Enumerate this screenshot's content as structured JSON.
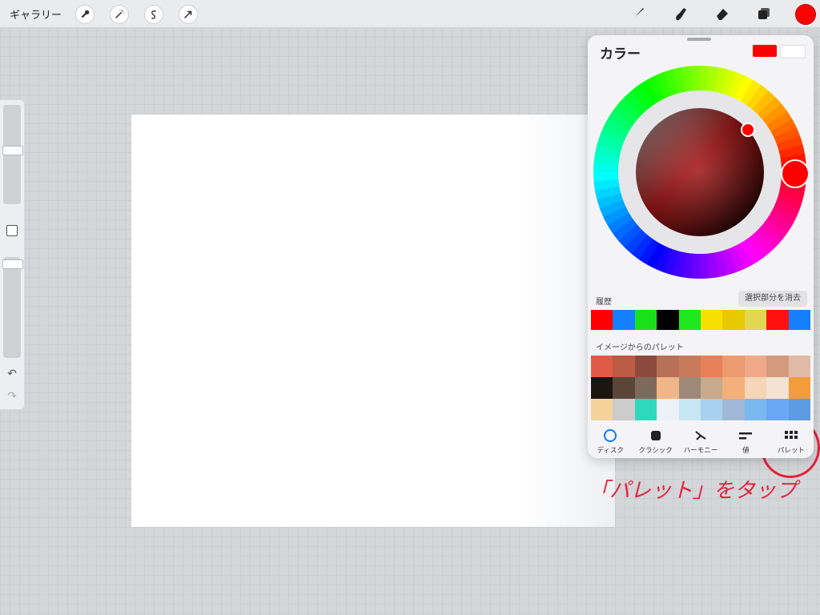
{
  "topbar": {
    "gallery_label": "ギャラリー",
    "left_tools": [
      "wrench-icon",
      "magic-wand-icon",
      "selection-icon",
      "transform-arrow-icon"
    ],
    "right_tools": [
      "brush-icon",
      "smudge-icon",
      "eraser-icon",
      "layers-icon"
    ],
    "current_color": "#ff0000"
  },
  "sidebar": {
    "top_slider_value": 0.45,
    "bottom_slider_value": 0.03,
    "undo_icon": "↶",
    "redo_icon": "↷"
  },
  "annotation": {
    "text": "「パレット」をタップ"
  },
  "color_panel": {
    "title": "カラー",
    "primary_color": "#ff0000",
    "secondary_color": "#ffffff",
    "history_label": "履歴",
    "clear_selection_label": "選択部分を消去",
    "history_colors": [
      "#ff0000",
      "#1480ff",
      "#1ae21a",
      "#000000",
      "#1ee81e",
      "#f7e000",
      "#e8c800",
      "#e2d850",
      "#ff1010",
      "#1480ff"
    ],
    "palette_label": "イメージからのパレット",
    "palette_colors": [
      "#e15a48",
      "#bc5a44",
      "#8c4a3e",
      "#b97058",
      "#c87a5c",
      "#e8805a",
      "#ec9a70",
      "#f0a888",
      "#d49a7e",
      "#e0bca8",
      "#1c1612",
      "#5a4638",
      "#7e6a5c",
      "#f0b688",
      "#a08878",
      "#c8aa8c",
      "#f4b07a",
      "#f6d6b8",
      "#f4e2d2",
      "#f49c3c",
      "#f4d29a",
      "#cccccc",
      "#2ed8bc",
      "#eaf2f8",
      "#c6e6f4",
      "#a8d0f0",
      "#a0b8d8",
      "#7ab8f0",
      "#6aa8f4",
      "#5c9ce0"
    ],
    "tabs": [
      {
        "label": "ディスク",
        "icon": "disc-icon"
      },
      {
        "label": "クラシック",
        "icon": "classic-square-icon"
      },
      {
        "label": "ハーモニー",
        "icon": "harmony-icon"
      },
      {
        "label": "値",
        "icon": "value-sliders-icon"
      },
      {
        "label": "パレット",
        "icon": "palette-grid-icon"
      }
    ]
  }
}
